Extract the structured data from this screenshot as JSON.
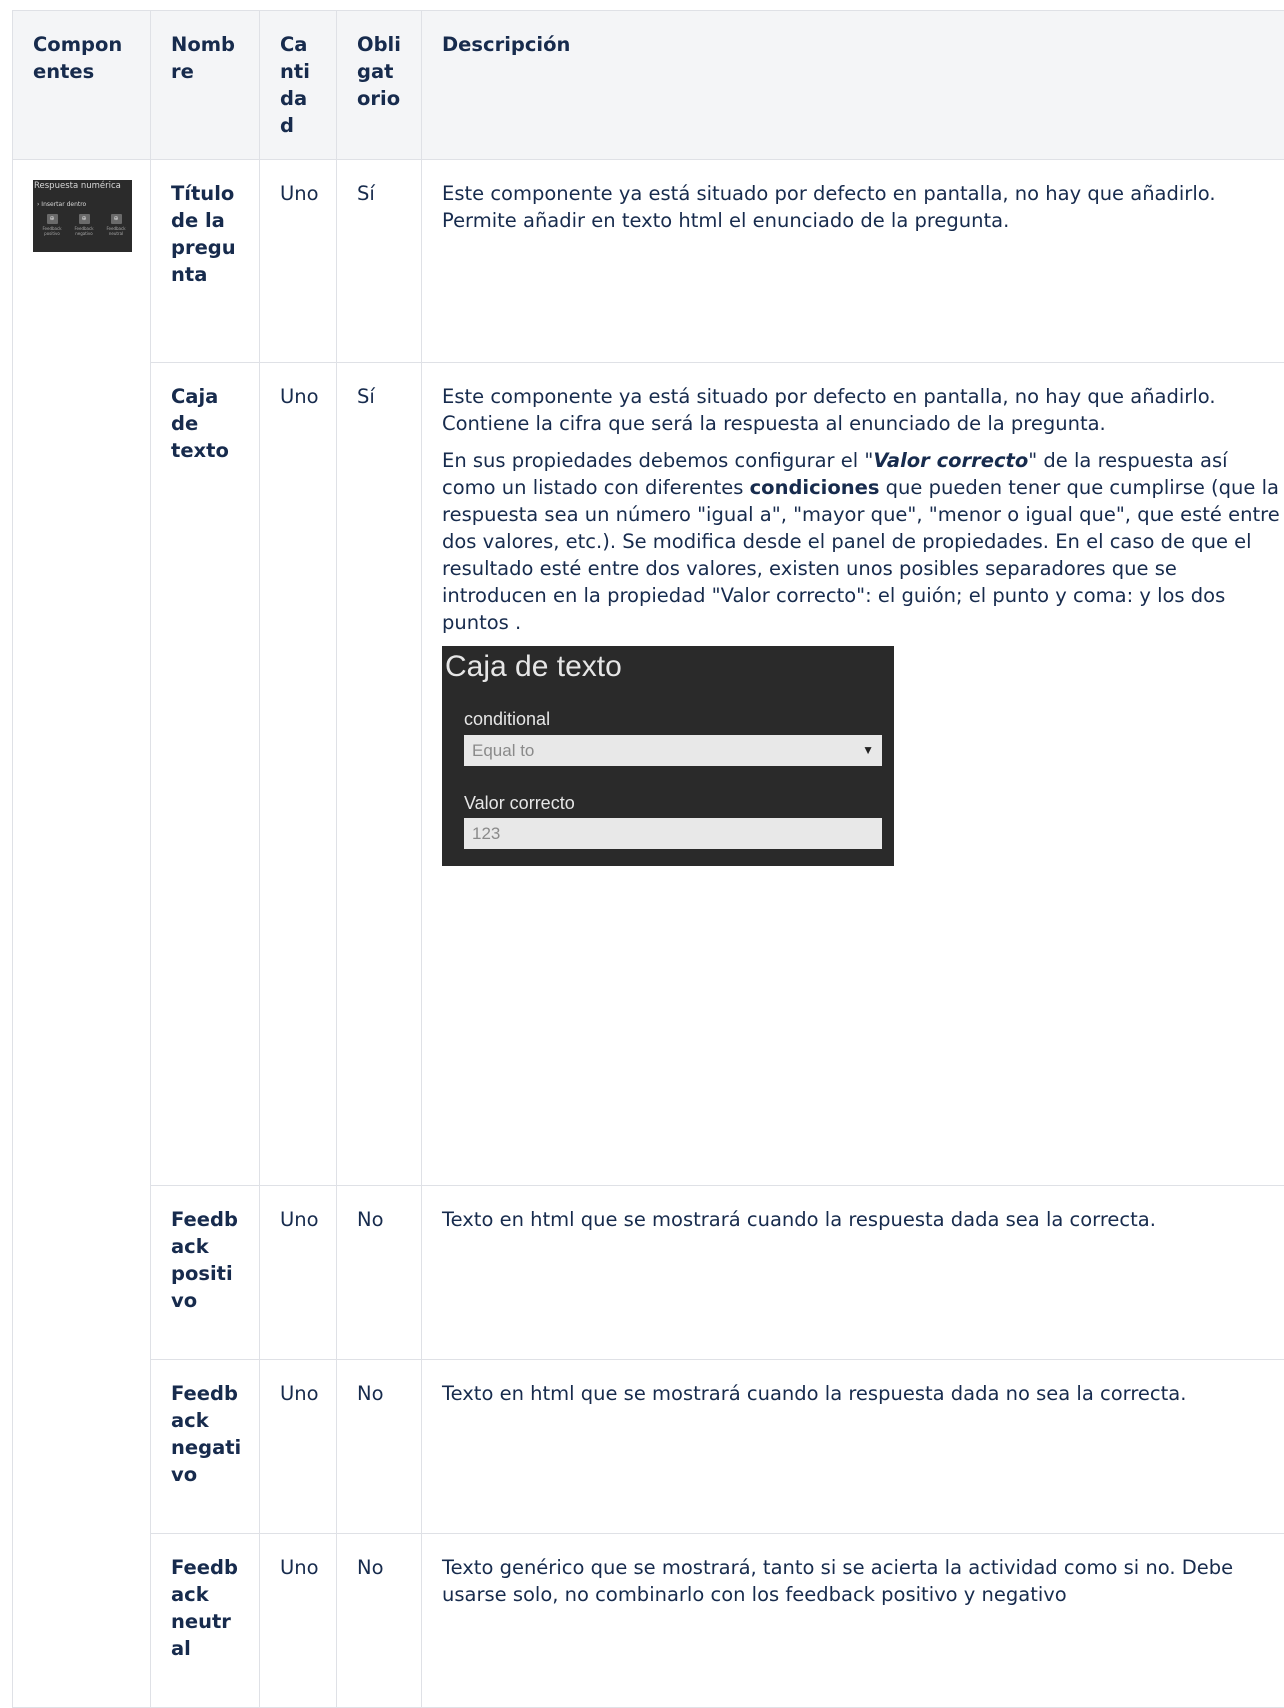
{
  "headers": {
    "componentes": "Componentes",
    "nombre": "Nombre",
    "cantidad": "Cantidad",
    "obligatorio": "Obligatorio",
    "descripcion": "Descripción"
  },
  "thumbnail": {
    "title": "Respuesta numérica",
    "subtitle": "› Insertar dentro",
    "buttons": [
      "Feedback positivo",
      "Feedback negativo",
      "Feedback neutral"
    ]
  },
  "rows": [
    {
      "nombre": "Título de la pregunta",
      "cantidad": "Uno",
      "obligatorio": "Sí",
      "descripcion": "Este componente ya está situado por defecto en pantalla, no hay que añadirlo. Permite añadir en texto html el enunciado de la pregunta."
    },
    {
      "nombre": "Caja de texto",
      "cantidad": "Uno",
      "obligatorio": "Sí",
      "descripcion": "Este componente ya está situado por defecto en pantalla, no hay que añadirlo. Contiene la cifra que será la respuesta al enunciado de la pregunta.",
      "p2_a": "En sus propiedades debemos configurar el \"",
      "p2_b": "Valor correcto",
      "p2_c": "\" de la respuesta así como un listado con diferentes ",
      "p2_d": "condiciones",
      "p2_e": " que pueden tener que cumplirse (que la respuesta sea un número \"igual a\", \"mayor que\", \"menor o igual que\", que esté entre dos valores, etc.). Se modifica desde el panel de propiedades. En el caso de que el resultado esté entre dos valores, existen unos posibles separadores que se introducen en la propiedad \"Valor correcto\": el guión; el punto y coma: y los dos puntos ."
    },
    {
      "nombre": "Feedback positivo",
      "cantidad": "Uno",
      "obligatorio": "No",
      "descripcion": "Texto en html que se mostrará cuando la respuesta dada sea la correcta."
    },
    {
      "nombre": "Feedback negativo",
      "cantidad": "Uno",
      "obligatorio": "No",
      "descripcion": "Texto en html que se mostrará cuando la respuesta dada no sea la correcta."
    },
    {
      "nombre": "Feedback neutral",
      "cantidad": "Uno",
      "obligatorio": "No",
      "descripcion": "Texto genérico que se mostrará, tanto si se acierta la actividad como si no. Debe usarse solo, no combinarlo con los feedback positivo y negativo"
    }
  ],
  "panel": {
    "title": "Caja de texto",
    "label_conditional": "conditional",
    "select_value": "Equal to",
    "label_valor": "Valor correcto",
    "input_value": "123"
  }
}
